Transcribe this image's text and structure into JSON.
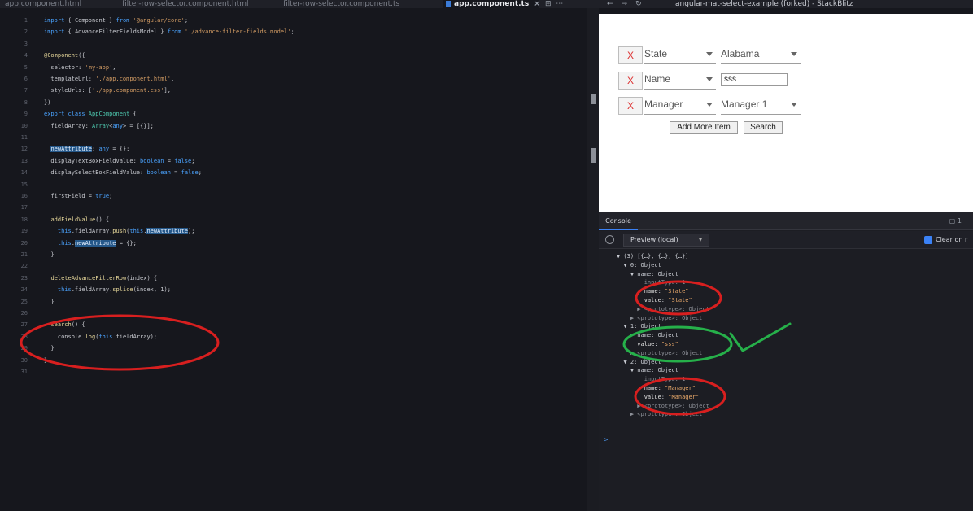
{
  "tabs": [
    {
      "label": "app.component.html",
      "active": false
    },
    {
      "label": "filter-row-selector.component.html",
      "active": false
    },
    {
      "label": "filter-row-selector.component.ts",
      "active": false
    },
    {
      "label": "app.component.ts",
      "active": true
    }
  ],
  "browser": {
    "url": "angular-mat-select-example (forked) - StackBlitz"
  },
  "editor": {
    "lines": [
      {
        "n": "1",
        "html": "<span class='kw'>import</span> { Component } <span class='kw'>from</span> <span class='str'>'@angular/core'</span>;"
      },
      {
        "n": "2",
        "html": "<span class='kw'>import</span> { AdvanceFilterFieldsModel } <span class='kw'>from</span> <span class='str'>'./advance-filter-fields.model'</span>;"
      },
      {
        "n": "3",
        "html": ""
      },
      {
        "n": "4",
        "html": "<span class='fn'>@Component</span>({"
      },
      {
        "n": "5",
        "html": "  selector: <span class='str'>'my-app'</span>,"
      },
      {
        "n": "6",
        "html": "  templateUrl: <span class='str'>'./app.component.html'</span>,"
      },
      {
        "n": "7",
        "html": "  styleUrls: [<span class='str'>'./app.component.css'</span>],"
      },
      {
        "n": "8",
        "html": "})"
      },
      {
        "n": "9",
        "html": "<span class='kw'>export class</span> <span class='ty'>AppComponent</span> {"
      },
      {
        "n": "10",
        "html": "  fieldArray: <span class='ty'>Array</span>&lt;<span class='kw'>any</span>&gt; = [{}];"
      },
      {
        "n": "11",
        "html": ""
      },
      {
        "n": "12",
        "html": "  <span class='hl'>newAttribute</span>: <span class='kw'>any</span> = {};"
      },
      {
        "n": "13",
        "html": "  displayTextBoxFieldValue: <span class='kw'>boolean</span> = <span class='kw'>false</span>;"
      },
      {
        "n": "14",
        "html": "  displaySelectBoxFieldValue: <span class='kw'>boolean</span> = <span class='kw'>false</span>;"
      },
      {
        "n": "15",
        "html": ""
      },
      {
        "n": "16",
        "html": "  firstField = <span class='kw'>true</span>;"
      },
      {
        "n": "17",
        "html": ""
      },
      {
        "n": "18",
        "html": "  <span class='fn'>addFieldValue</span>() {"
      },
      {
        "n": "19",
        "html": "    <span class='kw'>this</span>.fieldArray.<span class='fn'>push</span>(<span class='kw'>this</span>.<span class='hl'>newAttribute</span>);"
      },
      {
        "n": "20",
        "html": "    <span class='kw'>this</span>.<span class='hl'>newAttribute</span> = {};"
      },
      {
        "n": "21",
        "html": "  }"
      },
      {
        "n": "22",
        "html": ""
      },
      {
        "n": "23",
        "html": "  <span class='fn'>deleteAdvanceFilterRow</span>(index) {"
      },
      {
        "n": "24",
        "html": "    <span class='kw'>this</span>.fieldArray.<span class='fn'>splice</span>(index, 1);"
      },
      {
        "n": "25",
        "html": "  }"
      },
      {
        "n": "26",
        "html": ""
      },
      {
        "n": "27",
        "html": "  <span class='fn'>search</span>() {"
      },
      {
        "n": "28",
        "html": "    console.<span class='fn'>log</span>(<span class='kw'>this</span>.fieldArray);"
      },
      {
        "n": "29",
        "html": "  }"
      },
      {
        "n": "30",
        "html": "}"
      },
      {
        "n": "31",
        "html": ""
      }
    ]
  },
  "preview": {
    "rows": [
      {
        "remove": "X",
        "field": "State",
        "value": "Alabama",
        "kind": "select"
      },
      {
        "remove": "X",
        "field": "Name",
        "value": "sss",
        "kind": "text"
      },
      {
        "remove": "X",
        "field": "Manager",
        "value": "Manager 1",
        "kind": "select"
      }
    ],
    "add_label": "Add More Item",
    "search_label": "Search"
  },
  "devtools": {
    "tab": "Console",
    "count": "1",
    "context": "Preview (local)",
    "clear_label": "Clear on r",
    "prompt": ">",
    "log": [
      {
        "html": "<span class='arrow'>▼</span> (3) [{…}, {…}, {…}]"
      },
      {
        "html": "  <span class='arrow'>▼</span> 0: Object"
      },
      {
        "html": "    <span class='arrow'>▼</span> name: Object"
      },
      {
        "html": "        <span class='dim'>inputType: 1</span>"
      },
      {
        "html": "        <span class='k'>name</span>: <span class='s'>\"State\"</span>"
      },
      {
        "html": "        <span class='k'>value</span>: <span class='s'>\"State\"</span>"
      },
      {
        "html": "      <span class='dim'>▶ &lt;prototype&gt;: Object</span>"
      },
      {
        "html": "    <span class='dim'>▶ &lt;prototype&gt;: Object</span>"
      },
      {
        "html": "  <span class='arrow'>▼</span> 1: Object"
      },
      {
        "html": "    <span class='arrow'>▶</span> name: Object"
      },
      {
        "html": "      <span class='k'>value</span>: <span class='s'>\"sss\"</span>"
      },
      {
        "html": "    <span class='dim'>▶ &lt;prototype&gt;: Object</span>"
      },
      {
        "html": "  <span class='arrow'>▼</span> 2: Object"
      },
      {
        "html": "    <span class='arrow'>▼</span> name: Object"
      },
      {
        "html": "        <span class='dim'>inputType: 1</span>"
      },
      {
        "html": "        <span class='k'>name</span>: <span class='s'>\"Manager\"</span>"
      },
      {
        "html": "        <span class='k'>value</span>: <span class='s'>\"Manager\"</span>"
      },
      {
        "html": "      <span class='dim'>▶ &lt;prototype&gt;: Object</span>"
      },
      {
        "html": "    <span class='dim'>▶ &lt;prototype&gt;: Object</span>"
      }
    ]
  },
  "colors": {
    "red_annotation": "#d81f1f",
    "green_annotation": "#26b04a",
    "accent": "#3b82f6"
  }
}
